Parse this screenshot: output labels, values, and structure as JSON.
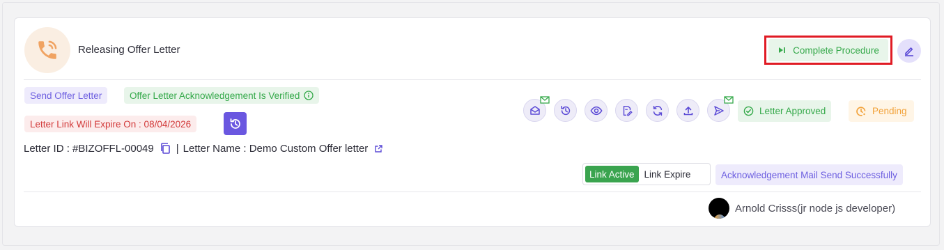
{
  "header": {
    "title": "Releasing Offer Letter",
    "complete_label": "Complete Procedure"
  },
  "tags": {
    "send_offer": "Send Offer Letter",
    "ack_verified": "Offer Letter Acknowledgement Is Verified",
    "expire": "Letter Link Will Expire On : 08/04/2026",
    "approved": "Letter Approved",
    "pending": "Pending",
    "ack_mail": "Acknowledgement Mail Send Successfully"
  },
  "letter": {
    "id_label": "Letter ID : #BIZOFFL-00049",
    "sep": "|",
    "name_label": "Letter Name : Demo Custom Offer letter"
  },
  "link_toggle": {
    "active": "Link Active",
    "expire": "Link Expire"
  },
  "user": {
    "name": "Arnold Crisss(jr node js developer)"
  },
  "colors": {
    "accent": "#6a57e0",
    "success": "#35a94a",
    "danger": "#d23a3a",
    "warning": "#f2a23a",
    "highlight": "#e01b24"
  }
}
